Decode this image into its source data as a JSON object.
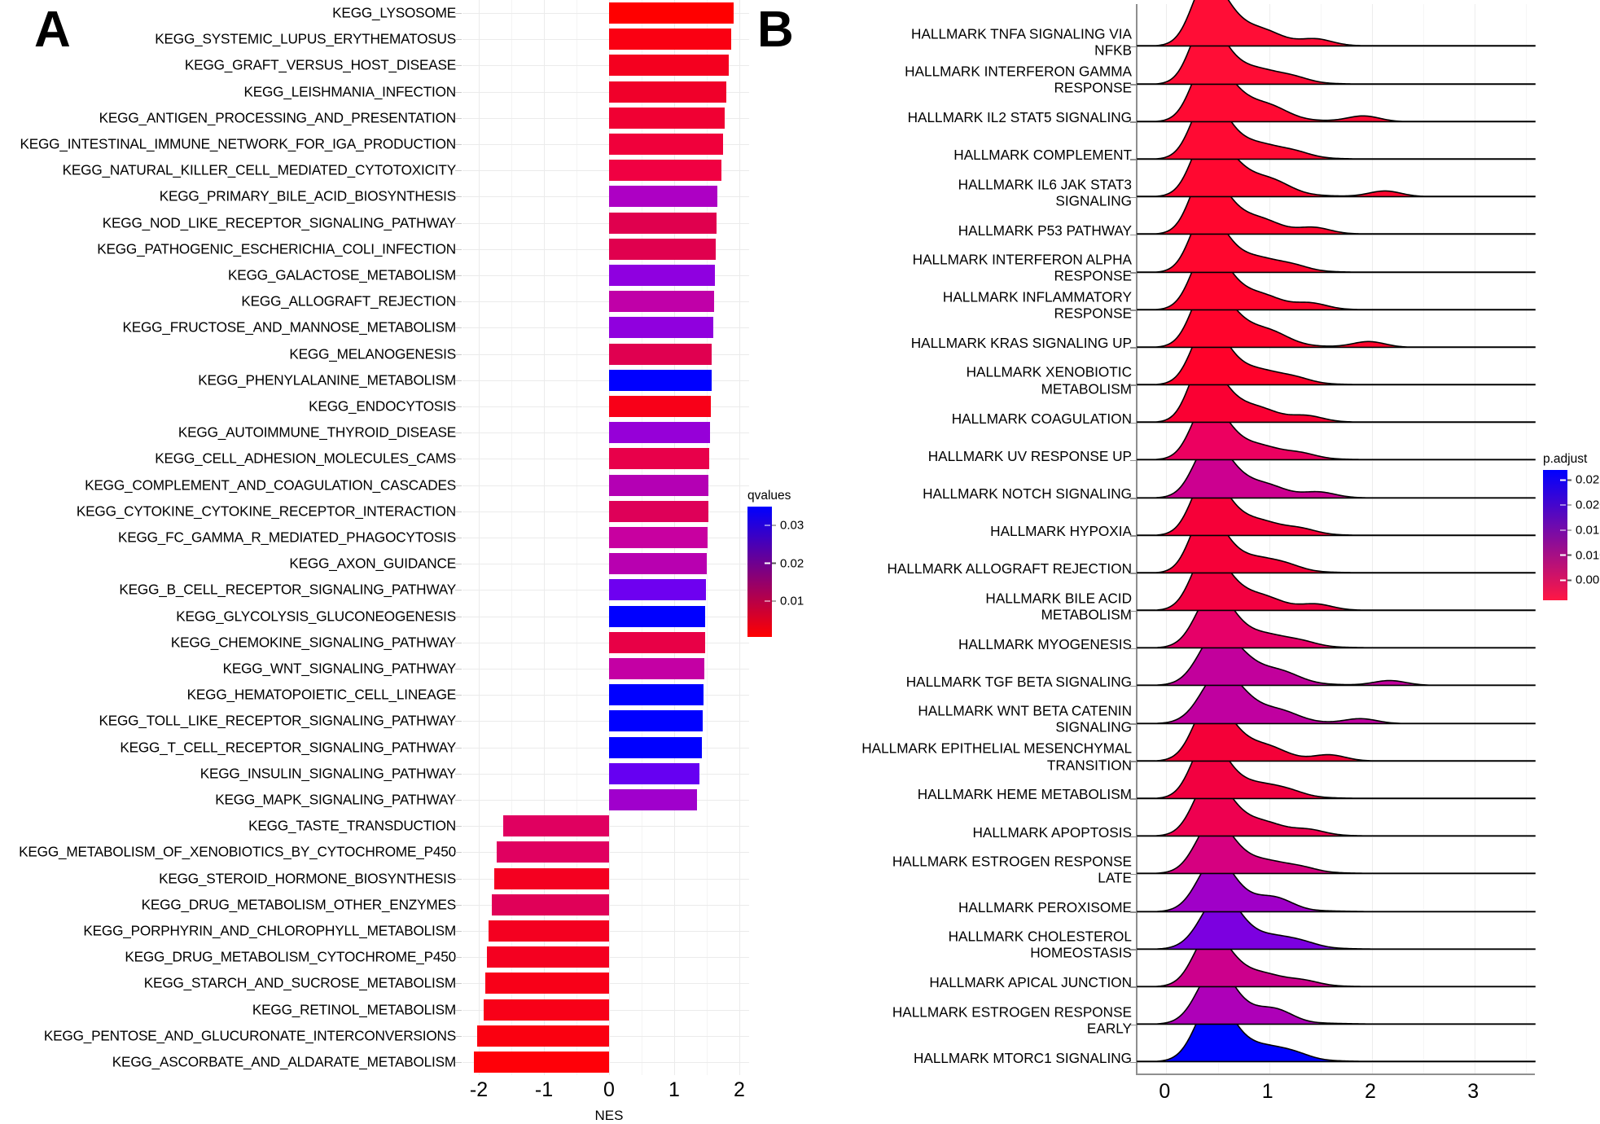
{
  "panels": {
    "a": {
      "letter": "A",
      "axis_title": "NES",
      "x_ticks": [
        "-2",
        "-1",
        "0",
        "1",
        "2"
      ],
      "x_tick_values": [
        -2,
        -1,
        0,
        1,
        2
      ],
      "legend": {
        "title": "qvalues",
        "ticks": [
          "0.03",
          "0.02",
          "0.01"
        ],
        "tick_values": [
          0.03,
          0.02,
          0.01
        ],
        "color_high": "#0000ff",
        "color_low": "#ff0000",
        "domain": [
          0.0005,
          0.035
        ]
      }
    },
    "b": {
      "letter": "B",
      "x_ticks": [
        "0",
        "1",
        "2",
        "3"
      ],
      "x_tick_values": [
        0,
        1,
        2,
        3
      ],
      "legend": {
        "title": "p.adjust",
        "ticks": [
          "0.005",
          "0.010",
          "0.015",
          "0.020",
          "0.025"
        ],
        "tick_values": [
          0.005,
          0.01,
          0.015,
          0.02,
          0.025
        ],
        "color_high": "#0000ff",
        "color_low": "#ff1744",
        "domain": [
          0.001,
          0.027
        ]
      }
    }
  },
  "chart_data": [
    {
      "type": "bar",
      "title": "",
      "xlabel": "NES",
      "ylabel": "",
      "xlim": [
        -2.25,
        2.15
      ],
      "grid": true,
      "orientation": "horizontal",
      "color_scale": {
        "name": "qvalues",
        "low_color": "#ff0000",
        "high_color": "#0000ff",
        "range": [
          0.0005,
          0.035
        ]
      },
      "categories": [
        "KEGG_LYSOSOME",
        "KEGG_SYSTEMIC_LUPUS_ERYTHEMATOSUS",
        "KEGG_GRAFT_VERSUS_HOST_DISEASE",
        "KEGG_LEISHMANIA_INFECTION",
        "KEGG_ANTIGEN_PROCESSING_AND_PRESENTATION",
        "KEGG_INTESTINAL_IMMUNE_NETWORK_FOR_IGA_PRODUCTION",
        "KEGG_NATURAL_KILLER_CELL_MEDIATED_CYTOTOXICITY",
        "KEGG_PRIMARY_BILE_ACID_BIOSYNTHESIS",
        "KEGG_NOD_LIKE_RECEPTOR_SIGNALING_PATHWAY",
        "KEGG_PATHOGENIC_ESCHERICHIA_COLI_INFECTION",
        "KEGG_GALACTOSE_METABOLISM",
        "KEGG_ALLOGRAFT_REJECTION",
        "KEGG_FRUCTOSE_AND_MANNOSE_METABOLISM",
        "KEGG_MELANOGENESIS",
        "KEGG_PHENYLALANINE_METABOLISM",
        "KEGG_ENDOCYTOSIS",
        "KEGG_AUTOIMMUNE_THYROID_DISEASE",
        "KEGG_CELL_ADHESION_MOLECULES_CAMS",
        "KEGG_COMPLEMENT_AND_COAGULATION_CASCADES",
        "KEGG_CYTOKINE_CYTOKINE_RECEPTOR_INTERACTION",
        "KEGG_FC_GAMMA_R_MEDIATED_PHAGOCYTOSIS",
        "KEGG_AXON_GUIDANCE",
        "KEGG_B_CELL_RECEPTOR_SIGNALING_PATHWAY",
        "KEGG_GLYCOLYSIS_GLUCONEOGENESIS",
        "KEGG_CHEMOKINE_SIGNALING_PATHWAY",
        "KEGG_WNT_SIGNALING_PATHWAY",
        "KEGG_HEMATOPOIETIC_CELL_LINEAGE",
        "KEGG_TOLL_LIKE_RECEPTOR_SIGNALING_PATHWAY",
        "KEGG_T_CELL_RECEPTOR_SIGNALING_PATHWAY",
        "KEGG_INSULIN_SIGNALING_PATHWAY",
        "KEGG_MAPK_SIGNALING_PATHWAY",
        "KEGG_TASTE_TRANSDUCTION",
        "KEGG_METABOLISM_OF_XENOBIOTICS_BY_CYTOCHROME_P450",
        "KEGG_STEROID_HORMONE_BIOSYNTHESIS",
        "KEGG_DRUG_METABOLISM_OTHER_ENZYMES",
        "KEGG_PORPHYRIN_AND_CHLOROPHYLL_METABOLISM",
        "KEGG_DRUG_METABOLISM_CYTOCHROME_P450",
        "KEGG_STARCH_AND_SUCROSE_METABOLISM",
        "KEGG_RETINOL_METABOLISM",
        "KEGG_PENTOSE_AND_GLUCURONATE_INTERCONVERSIONS",
        "KEGG_ASCORBATE_AND_ALDARATE_METABOLISM"
      ],
      "values": [
        1.91,
        1.88,
        1.84,
        1.8,
        1.78,
        1.75,
        1.72,
        1.66,
        1.65,
        1.64,
        1.62,
        1.61,
        1.6,
        1.58,
        1.57,
        1.56,
        1.55,
        1.54,
        1.53,
        1.52,
        1.51,
        1.5,
        1.49,
        1.48,
        1.47,
        1.46,
        1.45,
        1.44,
        1.43,
        1.39,
        1.35,
        -1.62,
        -1.72,
        -1.76,
        -1.8,
        -1.85,
        -1.88,
        -1.9,
        -1.92,
        -2.02,
        -2.07
      ],
      "colors": [
        "#ff0000",
        "#fa0012",
        "#f4001f",
        "#f0002a",
        "#f00033",
        "#f0003b",
        "#f00042",
        "#ad00c4",
        "#e0004e",
        "#e0004e",
        "#8f00e0",
        "#c000a8",
        "#9000de",
        "#e00050",
        "#0000ff",
        "#f80018",
        "#9600d8",
        "#e8004a",
        "#b400b4",
        "#de0058",
        "#c800a0",
        "#b800b0",
        "#6e00f0",
        "#0000ff",
        "#e80046",
        "#c400a4",
        "#0000ff",
        "#0000ff",
        "#0000ff",
        "#6600f2",
        "#a000cc",
        "#e00060",
        "#e00060",
        "#f40020",
        "#e00058",
        "#f40020",
        "#f40020",
        "#f80018",
        "#f80018",
        "#fa0010",
        "#ff0008"
      ],
      "q_values": [
        0.0008,
        0.0015,
        0.002,
        0.0025,
        0.003,
        0.0035,
        0.004,
        0.021,
        0.0048,
        0.005,
        0.0262,
        0.019,
        0.024,
        0.0055,
        0.033,
        0.0012,
        0.025,
        0.006,
        0.02,
        0.007,
        0.0185,
        0.0195,
        0.029,
        0.033,
        0.0065,
        0.0192,
        0.033,
        0.033,
        0.033,
        0.0295,
        0.023,
        0.008,
        0.008,
        0.003,
        0.0075,
        0.003,
        0.003,
        0.002,
        0.002,
        0.0014,
        0.0006
      ]
    },
    {
      "type": "area",
      "subtype": "ridgeline",
      "title": "",
      "xlabel": "",
      "ylabel": "",
      "xlim": [
        -0.28,
        3.6
      ],
      "grid": true,
      "color_scale": {
        "name": "p.adjust",
        "low_color": "#ff1744",
        "high_color": "#0000ff",
        "range": [
          0.001,
          0.027
        ]
      },
      "categories": [
        "HALLMARK TNFA SIGNALING VIA NFKB",
        "HALLMARK INTERFERON GAMMA RESPONSE",
        "HALLMARK IL2 STAT5 SIGNALING",
        "HALLMARK COMPLEMENT",
        "HALLMARK IL6 JAK STAT3 SIGNALING",
        "HALLMARK P53 PATHWAY",
        "HALLMARK INTERFERON ALPHA RESPONSE",
        "HALLMARK INFLAMMATORY RESPONSE",
        "HALLMARK KRAS SIGNALING UP",
        "HALLMARK XENOBIOTIC METABOLISM",
        "HALLMARK COAGULATION",
        "HALLMARK UV RESPONSE UP",
        "HALLMARK NOTCH SIGNALING",
        "HALLMARK HYPOXIA",
        "HALLMARK ALLOGRAFT REJECTION",
        "HALLMARK BILE ACID METABOLISM",
        "HALLMARK MYOGENESIS",
        "HALLMARK TGF BETA SIGNALING",
        "HALLMARK WNT BETA CATENIN SIGNALING",
        "HALLMARK EPITHELIAL MESENCHYMAL TRANSITION",
        "HALLMARK HEME METABOLISM",
        "HALLMARK APOPTOSIS",
        "HALLMARK ESTROGEN RESPONSE LATE",
        "HALLMARK PEROXISOME",
        "HALLMARK CHOLESTEROL HOMEOSTASIS",
        "HALLMARK APICAL JUNCTION",
        "HALLMARK ESTROGEN RESPONSE EARLY",
        "HALLMARK MTORC1 SIGNALING"
      ],
      "p_adjust": [
        0.0018,
        0.0018,
        0.002,
        0.0022,
        0.0024,
        0.0026,
        0.0028,
        0.003,
        0.0032,
        0.0034,
        0.0038,
        0.006,
        0.0115,
        0.004,
        0.0042,
        0.0045,
        0.0075,
        0.0125,
        0.013,
        0.0048,
        0.005,
        0.0055,
        0.0105,
        0.019,
        0.0215,
        0.012,
        0.018,
        0.026
      ],
      "fill_colors": [
        "#ff0d36",
        "#ff0d36",
        "#ff0a33",
        "#ff0a33",
        "#ff0830",
        "#ff062e",
        "#ff062e",
        "#ff042c",
        "#ff042c",
        "#ff022a",
        "#fa0033",
        "#ec0060",
        "#cc0090",
        "#f60038",
        "#f60038",
        "#f20040",
        "#e60068",
        "#c2009c",
        "#c000a0",
        "#f40038",
        "#f20040",
        "#ee0050",
        "#d60080",
        "#a000c8",
        "#7c00e0",
        "#cc008c",
        "#ae00b8",
        "#0000ff"
      ],
      "peak_x": [
        0.42,
        0.4,
        0.42,
        0.42,
        0.42,
        0.4,
        0.4,
        0.42,
        0.42,
        0.42,
        0.38,
        0.42,
        0.45,
        0.42,
        0.4,
        0.42,
        0.48,
        0.52,
        0.55,
        0.45,
        0.42,
        0.45,
        0.48,
        0.5,
        0.55,
        0.45,
        0.5,
        0.48
      ],
      "peak_height": [
        1.0,
        0.95,
        0.95,
        0.95,
        0.95,
        0.95,
        0.92,
        0.95,
        0.95,
        0.92,
        0.92,
        0.88,
        0.85,
        0.92,
        0.92,
        0.9,
        0.85,
        0.8,
        0.78,
        0.92,
        0.9,
        0.88,
        0.8,
        0.8,
        0.82,
        0.82,
        0.85,
        0.95
      ],
      "tail_extent": [
        2.0,
        1.6,
        2.9,
        1.6,
        3.3,
        2.0,
        1.6,
        1.9,
        3.0,
        1.6,
        1.9,
        1.7,
        2.0,
        1.7,
        1.5,
        2.0,
        1.6,
        3.2,
        2.6,
        2.2,
        1.5,
        1.8,
        1.6,
        1.2,
        1.5,
        1.7,
        1.2,
        1.5
      ]
    }
  ]
}
